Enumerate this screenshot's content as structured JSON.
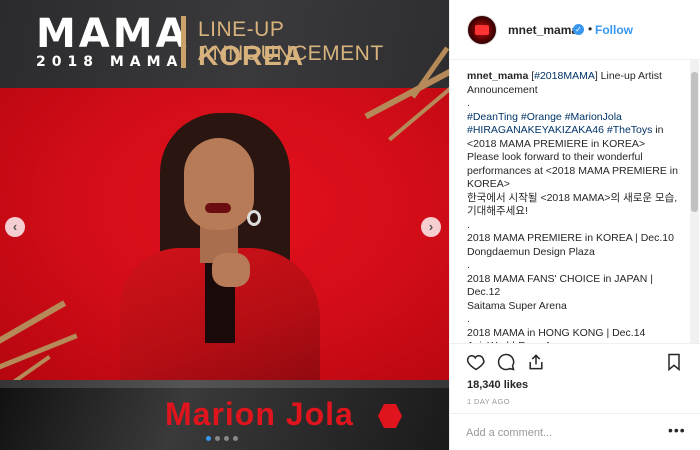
{
  "media": {
    "logo": "MAMA",
    "logo_sub": "2018 MAMA",
    "banner_title": "LINE-UP ANNOUNCEMENT",
    "banner_region": "KOREA",
    "artist_name": "Marion Jola",
    "prev_icon": "chevron-left-icon",
    "next_icon": "chevron-right-icon",
    "carousel": {
      "count": 4,
      "active_index": 0
    },
    "accent_color": "#e0141c",
    "gold_color": "#d7b27c"
  },
  "post": {
    "username": "mnet_mama",
    "verified_icon": "verified-badge-icon",
    "separator": "•",
    "follow_label": "Follow",
    "caption": {
      "user": "mnet_mama",
      "lines": [
        "[#2018MAMA] Line-up Artist Announcement",
        ".",
        "#DeanTing #Orange #MarionJola #HIRAGANAKEYAKIZAKA46 #TheToys in <2018 MAMA PREMIERE in KOREA>",
        "Please look forward to their wonderful performances at <2018 MAMA PREMIERE in KOREA>",
        "한국에서 시작될 <2018 MAMA>의 새로운 모습, 기대해주세요!",
        ".",
        "2018 MAMA PREMIERE in KOREA | Dec.10",
        "Dongdaemun Design Plaza",
        ".",
        "2018 MAMA FANS' CHOICE in JAPAN | Dec.12",
        "Saitama Super Arena",
        ".",
        "2018 MAMA in HONG KONG | Dec.14",
        "AsiaWorld-Expo Arena"
      ]
    },
    "likes": "18,340 likes",
    "time_ago": "1 DAY AGO",
    "comment_placeholder": "Add a comment...",
    "more_options": "•••",
    "icons": [
      "heart-icon",
      "comment-icon",
      "share-icon",
      "bookmark-icon"
    ]
  }
}
